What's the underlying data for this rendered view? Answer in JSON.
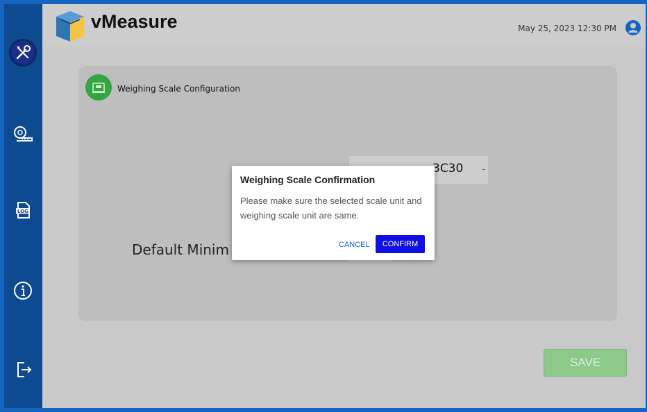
{
  "app": {
    "brand": "vMeasure",
    "datetime": "May 25, 2023 12:30 PM"
  },
  "sidebar": {
    "items": [
      {
        "icon": "tools-icon",
        "active": true
      },
      {
        "icon": "measuring-tape-icon",
        "active": false
      },
      {
        "icon": "log-icon",
        "active": false
      },
      {
        "icon": "info-icon",
        "active": false
      },
      {
        "icon": "logout-icon",
        "active": false
      }
    ]
  },
  "card": {
    "title": "Weighing Scale Configuration",
    "select_value": "3C30",
    "select_arrow": "-",
    "field_label": "Default Minim"
  },
  "save_label": "SAVE",
  "dialog": {
    "title": "Weighing Scale Confirmation",
    "body": "Please make sure the selected scale unit and weighing scale unit are same.",
    "cancel_label": "CANCEL",
    "confirm_label": "CONFIRM"
  },
  "colors": {
    "sidebar": "#0d4a8f",
    "frame": "#1565c0",
    "confirm": "#1010e0",
    "card_icon": "#35a541",
    "save": "#8cc98a"
  }
}
